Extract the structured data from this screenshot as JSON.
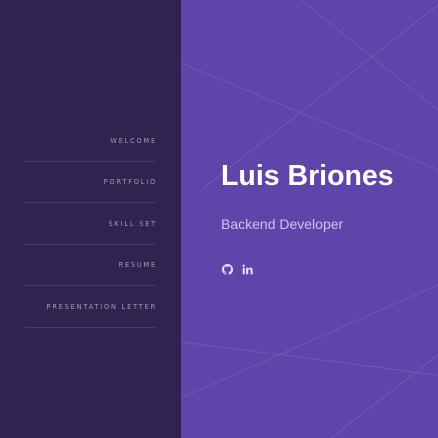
{
  "sidebar": {
    "nav_items": [
      {
        "label": "WELCOME"
      },
      {
        "label": "PORTFOLIO"
      },
      {
        "label": "SKILL SET"
      },
      {
        "label": "RESUME"
      },
      {
        "label": "PRESENTATION LETTER"
      }
    ]
  },
  "hero": {
    "name": "Luis Briones",
    "role": "Backend Developer",
    "social_icons": [
      "github-icon",
      "linkedin-icon"
    ]
  },
  "colors": {
    "sidebar_bg": "#30234f",
    "main_bg": "#5f45a9",
    "nav_text": "#a49bbd",
    "name_text": "#ffffff",
    "role_text": "#cfc5ee"
  }
}
